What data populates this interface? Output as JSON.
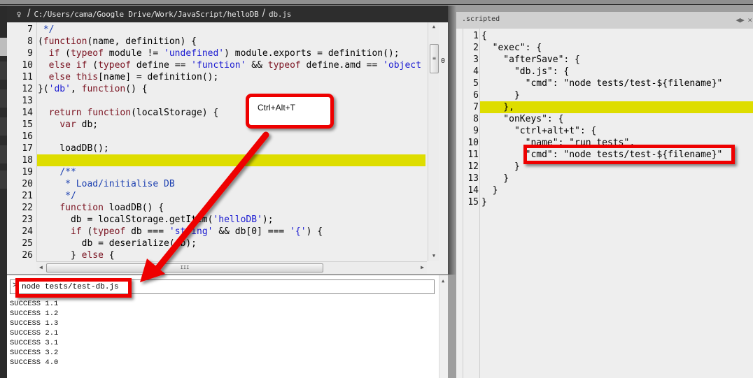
{
  "header": {
    "pin_icon": "pin-icon",
    "path": "C:/Users/cama/Google Drive/Work/JavaScript/helloDB",
    "file": "db.js"
  },
  "editor": {
    "highlighted_line": 18,
    "fold_marker": "0",
    "lines": [
      {
        "n": "7",
        "html": " <span class=\"cm\">*/</span>"
      },
      {
        "n": "8",
        "html": "(<span class=\"kw\">function</span>(name, definition) {"
      },
      {
        "n": "9",
        "html": "  <span class=\"kw\">if</span> (<span class=\"kw\">typeof</span> module != <span class=\"str\">'undefined'</span>) module.exports = definition();"
      },
      {
        "n": "10",
        "html": "  <span class=\"kw\">else if</span> (<span class=\"kw\">typeof</span> define == <span class=\"str\">'function'</span> &amp;&amp; <span class=\"kw\">typeof</span> define.amd == <span class=\"str\">'object</span>"
      },
      {
        "n": "11",
        "html": "  <span class=\"kw\">else this</span>[name] = definition();"
      },
      {
        "n": "12",
        "html": "}(<span class=\"str\">'db'</span>, <span class=\"kw\">function</span>() {"
      },
      {
        "n": "13",
        "html": ""
      },
      {
        "n": "14",
        "html": "  <span class=\"kw\">return function</span>(localStorage) {"
      },
      {
        "n": "15",
        "html": "    <span class=\"kw\">var</span> db;"
      },
      {
        "n": "16",
        "html": ""
      },
      {
        "n": "17",
        "html": "    loadDB();"
      },
      {
        "n": "18",
        "html": ""
      },
      {
        "n": "19",
        "html": "    <span class=\"cm\">/**</span>"
      },
      {
        "n": "20",
        "html": "<span class=\"cm\">     * Load/initialise DB</span>"
      },
      {
        "n": "21",
        "html": "<span class=\"cm\">     */</span>"
      },
      {
        "n": "22",
        "html": "    <span class=\"kw\">function</span> loadDB() {"
      },
      {
        "n": "23",
        "html": "      db = localStorage.getItem(<span class=\"str\">'helloDB'</span>);"
      },
      {
        "n": "24",
        "html": "      <span class=\"kw\">if</span> (<span class=\"kw\">typeof</span> db === <span class=\"str\">'string'</span> &amp;&amp; db[0] === <span class=\"str\">'{'</span>) {"
      },
      {
        "n": "25",
        "html": "        db = deserialize(db);"
      },
      {
        "n": "26",
        "html": "      } <span class=\"kw\">else</span> {"
      }
    ]
  },
  "console": {
    "prompt": ">",
    "input_value": "node tests/test-db.js",
    "output": [
      "SUCCESS 1.1",
      "SUCCESS 1.2",
      "SUCCESS 1.3",
      "SUCCESS 2.1",
      "SUCCESS 3.1",
      "SUCCESS 3.2",
      "SUCCESS 4.0"
    ]
  },
  "right_panel": {
    "title": ".scripted",
    "controls": "◀▶ ×",
    "highlighted_line": 7,
    "lines": [
      {
        "n": "1",
        "text": "{"
      },
      {
        "n": "2",
        "text": "  \"exec\": {"
      },
      {
        "n": "3",
        "text": "    \"afterSave\": {"
      },
      {
        "n": "4",
        "text": "      \"db.js\": {"
      },
      {
        "n": "5",
        "text": "        \"cmd\": \"node tests/test-${filename}\""
      },
      {
        "n": "6",
        "text": "      }"
      },
      {
        "n": "7",
        "text": "    },"
      },
      {
        "n": "8",
        "text": "    \"onKeys\": {"
      },
      {
        "n": "9",
        "text": "      \"ctrl+alt+t\": {"
      },
      {
        "n": "10",
        "text": "        \"name\": \"run tests\","
      },
      {
        "n": "11",
        "text": "        \"cmd\": \"node tests/test-${filename}\""
      },
      {
        "n": "12",
        "text": "      }"
      },
      {
        "n": "13",
        "text": "    }"
      },
      {
        "n": "14",
        "text": "  }"
      },
      {
        "n": "15",
        "text": "}"
      }
    ]
  },
  "annotations": {
    "callout_text": "Ctrl+Alt+T",
    "accent_color": "#ee0000",
    "highlight_color": "#dedd00"
  }
}
